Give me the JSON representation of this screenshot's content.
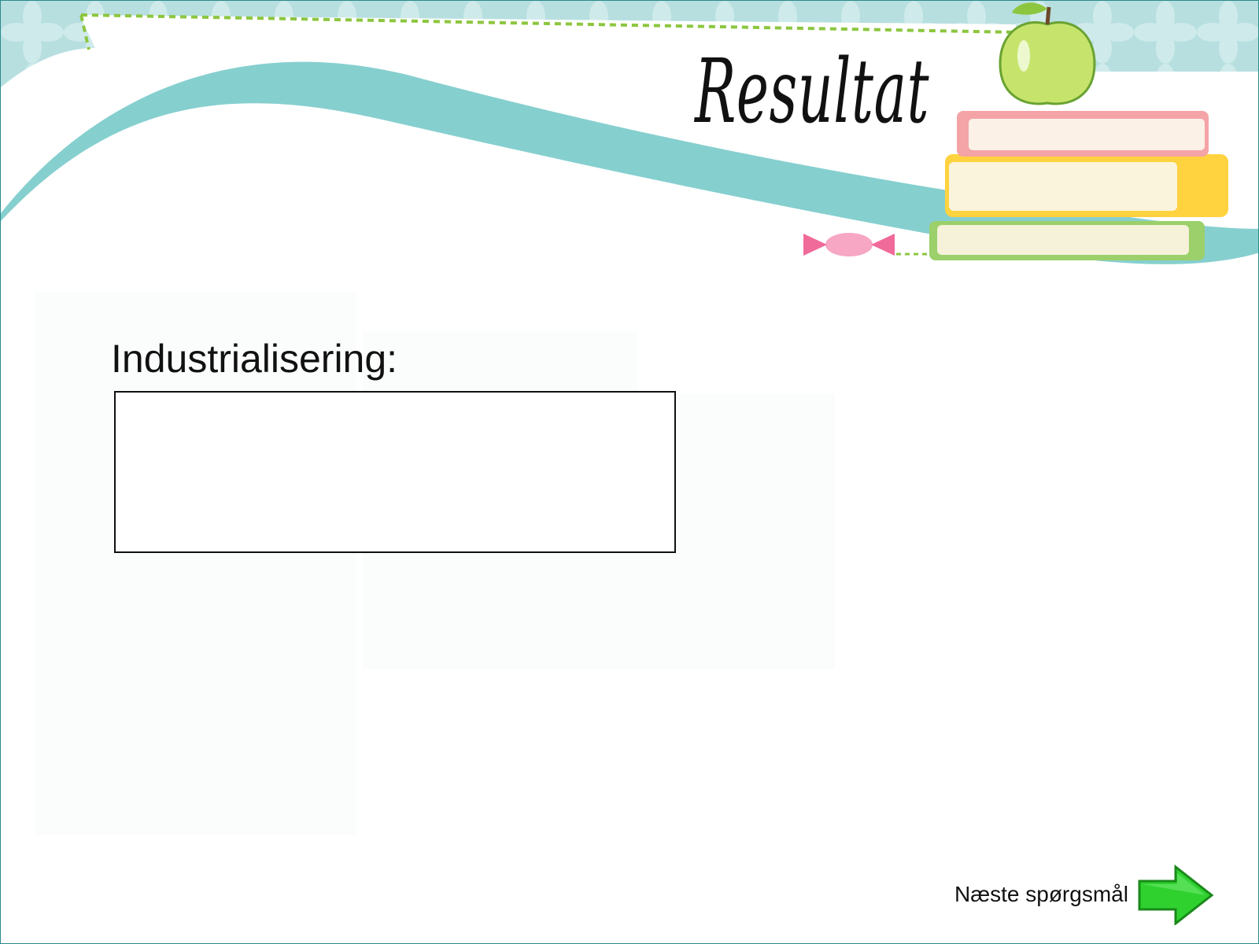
{
  "slide": {
    "title": "Resultat",
    "field_label": "Industrialisering:",
    "answer_value": "",
    "next_label": "Næste spørgsmål"
  },
  "colors": {
    "teal": "#86cfcf",
    "pattern_bg": "#b7dfe0",
    "dashed_green": "#8cc63f",
    "arrow_green": "#2fd12f",
    "book_pink": "#f4a3a6",
    "book_yellow": "#ffd23f",
    "book_green": "#9bd06a",
    "apple_green": "#c6e46c",
    "candy_pink": "#f06a9a"
  },
  "icons": {
    "next": "green-right-arrow-icon",
    "decor": [
      "apple-icon",
      "stacked-books-icon",
      "candy-icon"
    ]
  }
}
